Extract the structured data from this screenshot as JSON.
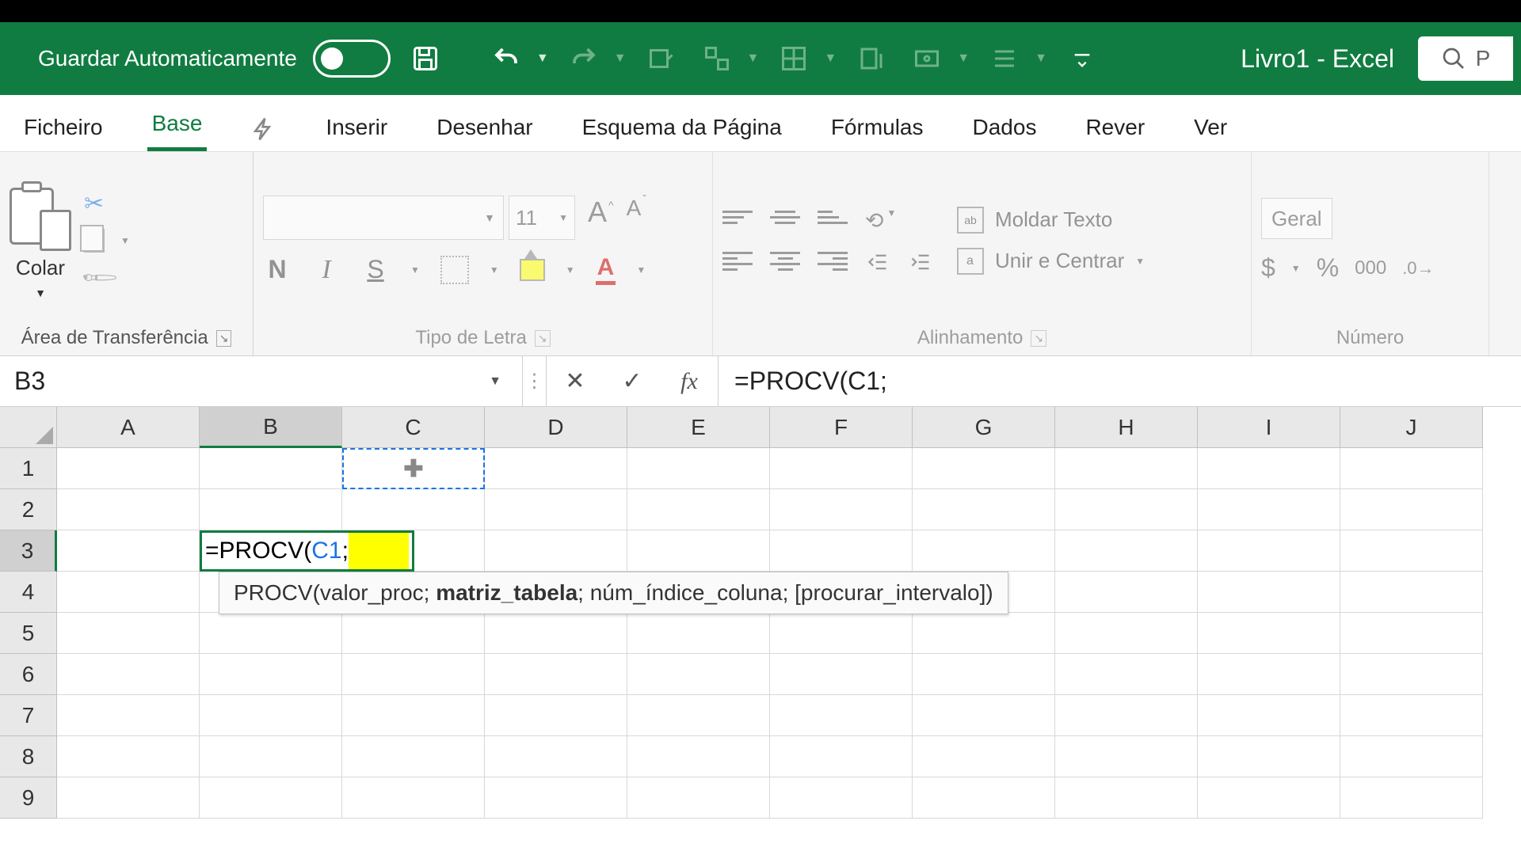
{
  "titlebar": {
    "autosave_label": "Guardar Automaticamente",
    "doc_title": "Livro1  -  Excel",
    "search_placeholder": "P"
  },
  "tabs": {
    "ficheiro": "Ficheiro",
    "base": "Base",
    "inserir": "Inserir",
    "desenhar": "Desenhar",
    "esquema": "Esquema da Página",
    "formulas": "Fórmulas",
    "dados": "Dados",
    "rever": "Rever",
    "ver": "Ver"
  },
  "ribbon": {
    "clipboard": {
      "paste": "Colar",
      "group_label": "Área de Transferência"
    },
    "font": {
      "size": "11",
      "group_label": "Tipo de Letra",
      "bold": "N",
      "italic": "I",
      "underline": "S",
      "fontcolor": "A"
    },
    "alignment": {
      "wrap": "Moldar Texto",
      "merge": "Unir e Centrar",
      "group_label": "Alinhamento"
    },
    "number": {
      "format": "Geral",
      "group_label": "Número",
      "currency": "$",
      "percent": "%",
      "thousand": "000"
    }
  },
  "formula_bar": {
    "cell_ref": "B3",
    "fx": "fx",
    "formula_prefix": "=PROCV(",
    "formula_ref": "C1",
    "formula_suffix": ";"
  },
  "grid": {
    "columns": [
      "A",
      "B",
      "C",
      "D",
      "E",
      "F",
      "G",
      "H",
      "I",
      "J"
    ],
    "rows": [
      "1",
      "2",
      "3",
      "4",
      "5",
      "6",
      "7",
      "8",
      "9"
    ]
  },
  "editing_cell": {
    "prefix": "=PROCV(",
    "ref": "C1",
    "suffix": ";"
  },
  "tooltip": {
    "func": "PROCV",
    "arg1": "valor_proc",
    "arg2": "matriz_tabela",
    "arg3": "núm_índice_coluna",
    "arg4": "[procurar_intervalo]"
  }
}
